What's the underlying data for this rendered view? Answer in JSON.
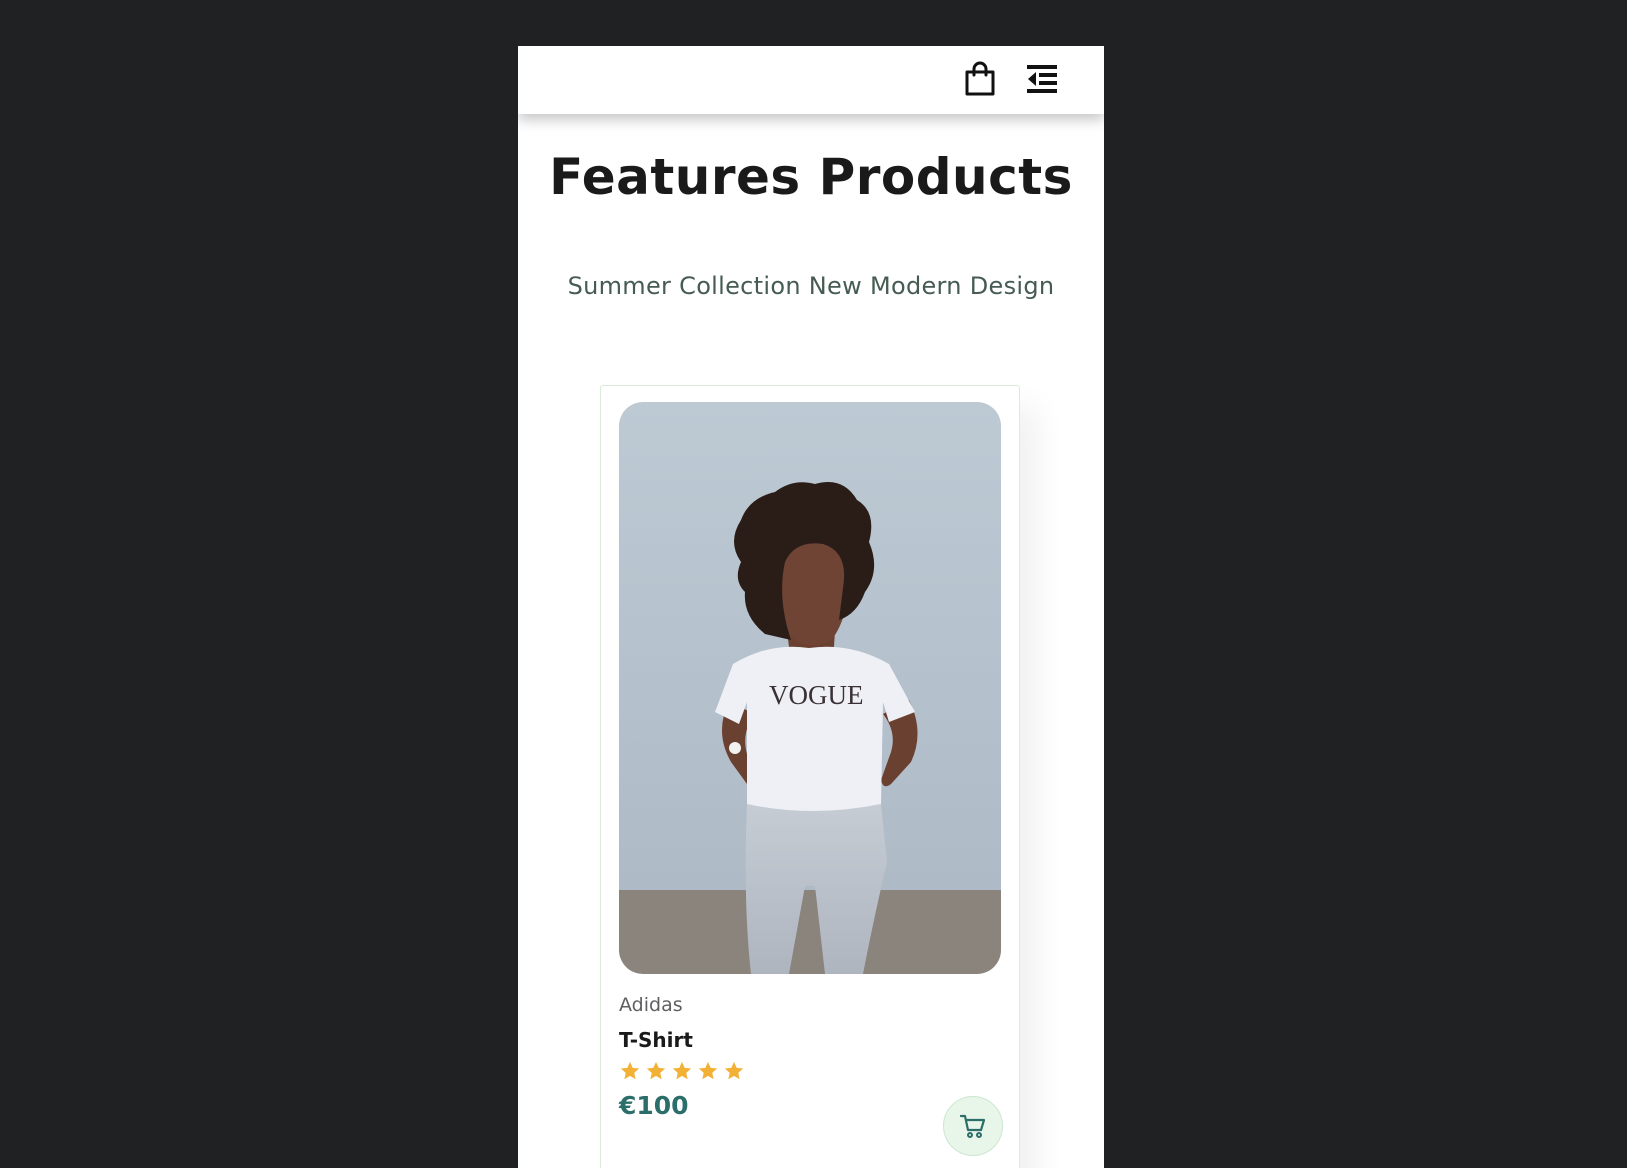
{
  "header": {
    "bag_icon": "shopping-bag-icon",
    "menu_icon": "menu-collapse-icon"
  },
  "section": {
    "title": "Features Products",
    "subtitle": "Summer Collection New Modern Design"
  },
  "products": [
    {
      "image_alt": "Woman wearing VOGUE T-shirt",
      "shirt_text": "VOGUE",
      "brand": "Adidas",
      "name": "T-Shirt",
      "rating": 5,
      "rating_max": 5,
      "price": "€100",
      "cart_icon": "cart-icon"
    }
  ],
  "colors": {
    "background": "#202123",
    "page": "#ffffff",
    "title": "#1a1a1a",
    "subtitle": "#465b52",
    "star": "#f2b034",
    "price": "#2b6e6a",
    "cart_button_bg": "#e8f6ea",
    "card_border": "#d8ecd8"
  }
}
